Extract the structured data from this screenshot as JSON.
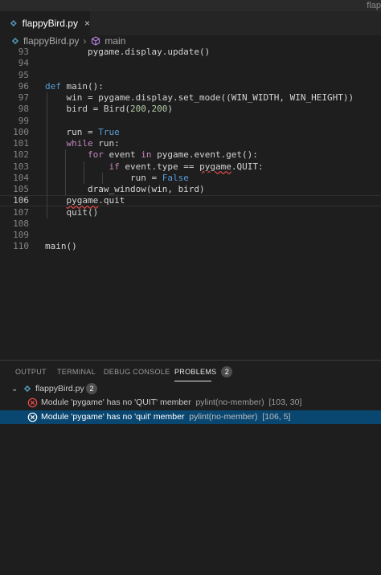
{
  "window": {
    "title": "flap"
  },
  "tab": {
    "filename": "flappyBird.py",
    "close_glyph": "×"
  },
  "breadcrumb": {
    "file": "flappyBird.py",
    "symbol": "main"
  },
  "editor": {
    "lines": [
      {
        "n": "93",
        "segs": [
          [
            "        pygame.display.update()",
            ""
          ]
        ]
      },
      {
        "n": "94",
        "segs": []
      },
      {
        "n": "95",
        "segs": []
      },
      {
        "n": "96",
        "segs": [
          [
            "def",
            "kw"
          ],
          [
            " main():",
            ""
          ]
        ]
      },
      {
        "n": "97",
        "segs": [
          [
            "    win = pygame.display.set_mode((WIN_WIDTH, WIN_HEIGHT))",
            ""
          ]
        ]
      },
      {
        "n": "98",
        "segs": [
          [
            "    bird = Bird(",
            ""
          ],
          [
            "200",
            "num"
          ],
          [
            ",",
            ""
          ],
          [
            "200",
            "num"
          ],
          [
            ")",
            ""
          ]
        ]
      },
      {
        "n": "99",
        "segs": []
      },
      {
        "n": "100",
        "segs": [
          [
            "    run = ",
            ""
          ],
          [
            "True",
            "kw"
          ]
        ]
      },
      {
        "n": "101",
        "segs": [
          [
            "    ",
            ""
          ],
          [
            "while",
            "ctl"
          ],
          [
            " run:",
            ""
          ]
        ]
      },
      {
        "n": "102",
        "segs": [
          [
            "        ",
            ""
          ],
          [
            "for",
            "ctl"
          ],
          [
            " event ",
            ""
          ],
          [
            "in",
            "ctl"
          ],
          [
            " pygame.event.get():",
            ""
          ]
        ]
      },
      {
        "n": "103",
        "segs": [
          [
            "            ",
            ""
          ],
          [
            "if",
            "ctl"
          ],
          [
            " event.type == ",
            ""
          ],
          [
            "pygame",
            "squig"
          ],
          [
            ".QUIT:",
            ""
          ]
        ]
      },
      {
        "n": "104",
        "segs": [
          [
            "                run = ",
            ""
          ],
          [
            "False",
            "kw"
          ]
        ]
      },
      {
        "n": "105",
        "segs": [
          [
            "        draw_window(win, bird)",
            ""
          ]
        ]
      },
      {
        "n": "106",
        "segs": [
          [
            "    ",
            ""
          ],
          [
            "pygame",
            "squig"
          ],
          [
            ".quit",
            ""
          ]
        ]
      },
      {
        "n": "107",
        "segs": [
          [
            "    quit()",
            ""
          ]
        ]
      },
      {
        "n": "108",
        "segs": []
      },
      {
        "n": "109",
        "segs": []
      },
      {
        "n": "110",
        "segs": [
          [
            "main()",
            ""
          ]
        ]
      }
    ],
    "current_line": "106"
  },
  "panel": {
    "tabs": [
      {
        "label": "OUTPUT",
        "active": false
      },
      {
        "label": "TERMINAL",
        "active": false
      },
      {
        "label": "DEBUG CONSOLE",
        "active": false
      },
      {
        "label": "PROBLEMS",
        "active": true
      }
    ],
    "problems_count": "2",
    "file_group": {
      "filename": "flappyBird.py",
      "count": "2"
    },
    "problems": [
      {
        "message": "Module 'pygame' has no 'QUIT' member",
        "source": "pylint(no-member)",
        "location": "[103, 30]",
        "selected": false
      },
      {
        "message": "Module 'pygame' has no 'quit' member",
        "source": "pylint(no-member)",
        "location": "[106, 5]",
        "selected": true
      }
    ]
  },
  "colors": {
    "editor_bg": "#1e1e1e",
    "keyword": "#569cd6",
    "control": "#c586c0",
    "number": "#b5cea8",
    "error": "#f14c4c",
    "selection": "#094771",
    "python_icon": "#519aba"
  },
  "icons": {
    "file": "python-file-icon",
    "symbol": "cube-icon",
    "problem": "error-circle-icon",
    "expand": "chevron-down-icon"
  }
}
